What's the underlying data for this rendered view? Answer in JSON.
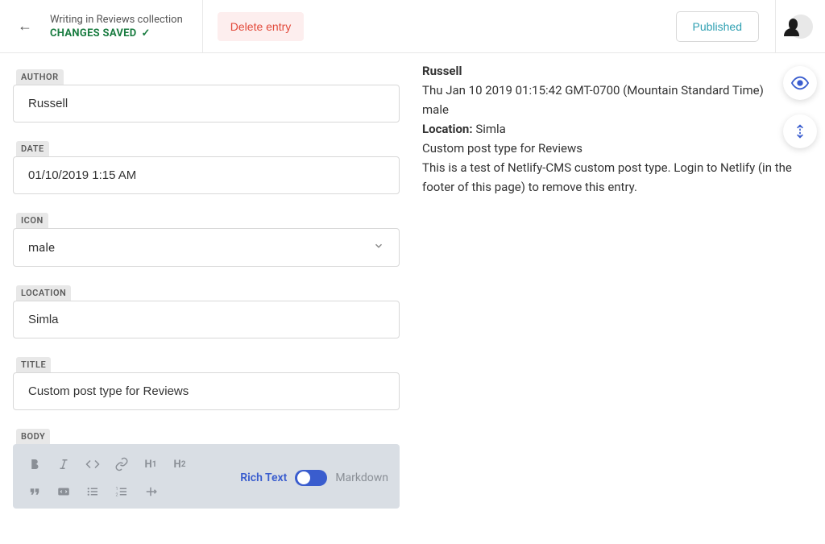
{
  "header": {
    "breadcrumb": "Writing in Reviews collection",
    "status": "CHANGES SAVED",
    "delete_label": "Delete entry",
    "published_label": "Published"
  },
  "fields": {
    "author": {
      "label": "AUTHOR",
      "value": "Russell"
    },
    "date": {
      "label": "DATE",
      "value": "01/10/2019 1:15 AM"
    },
    "icon": {
      "label": "ICON",
      "value": "male"
    },
    "location": {
      "label": "LOCATION",
      "value": "Simla"
    },
    "title": {
      "label": "TITLE",
      "value": "Custom post type for Reviews"
    },
    "body": {
      "label": "BODY"
    }
  },
  "editor_toolbar": {
    "mode_active": "Rich Text",
    "mode_inactive": "Markdown"
  },
  "preview": {
    "author": "Russell",
    "date": "Thu Jan 10 2019 01:15:42 GMT-0700 (Mountain Standard Time)",
    "icon": "male",
    "location_label": "Location:",
    "location_value": "Simla",
    "title": "Custom post type for Reviews",
    "body": "This is a test of Netlify-CMS custom post type. Login to Netlify (in the footer of this page) to remove this entry."
  }
}
